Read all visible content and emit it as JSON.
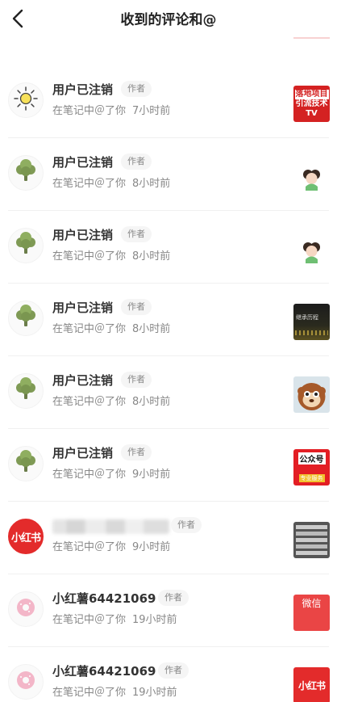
{
  "header": {
    "title": "收到的评论和@"
  },
  "items": [
    {
      "name": "用户已注销",
      "tag": "作者",
      "action": "在笔记中＠了你",
      "time": "7小时前",
      "avatar": "sun-icon",
      "thumb": {
        "kind": "red-text",
        "lines": [
          "落地项目",
          "引流技术",
          "TV"
        ]
      }
    },
    {
      "name": "用户已注销",
      "tag": "作者",
      "action": "在笔记中＠了你",
      "time": "8小时前",
      "avatar": "tree-icon",
      "thumb": {
        "kind": "girl"
      }
    },
    {
      "name": "用户已注销",
      "tag": "作者",
      "action": "在笔记中＠了你",
      "time": "8小时前",
      "avatar": "tree-icon",
      "thumb": {
        "kind": "girl"
      }
    },
    {
      "name": "用户已注销",
      "tag": "作者",
      "action": "在笔记中＠了你",
      "time": "8小时前",
      "avatar": "tree-icon",
      "thumb": {
        "kind": "dark-city",
        "lines": [
          "继承历程"
        ]
      }
    },
    {
      "name": "用户已注销",
      "tag": "作者",
      "action": "在笔记中＠了你",
      "time": "8小时前",
      "avatar": "tree-icon",
      "thumb": {
        "kind": "monkey"
      }
    },
    {
      "name": "用户已注销",
      "tag": "作者",
      "action": "在笔记中＠了你",
      "time": "9小时前",
      "avatar": "tree-icon",
      "thumb": {
        "kind": "official",
        "lines": [
          "公众号",
          "专业服务"
        ]
      }
    },
    {
      "name": "",
      "tag": "作者",
      "action": "在笔记中＠了你",
      "time": "9小时前",
      "avatar": "xiaohongshu-logo",
      "avatar_text": "小红书",
      "thumb": {
        "kind": "gray-list"
      }
    },
    {
      "name": "小红薯64421069",
      "tag": "作者",
      "action": "在笔记中＠了你",
      "time": "19小时前",
      "avatar": "donut-icon",
      "thumb": {
        "kind": "red-wechat",
        "lines": [
          "微信"
        ]
      }
    },
    {
      "name": "小红薯64421069",
      "tag": "作者",
      "action": "在笔记中＠了你",
      "time": "19小时前",
      "avatar": "donut-icon",
      "thumb": {
        "kind": "xhs-red",
        "lines": [
          "小红书"
        ]
      }
    }
  ],
  "colors": {
    "brand_red": "#e32b2b",
    "text_main": "#333333",
    "text_sub": "#888888"
  }
}
